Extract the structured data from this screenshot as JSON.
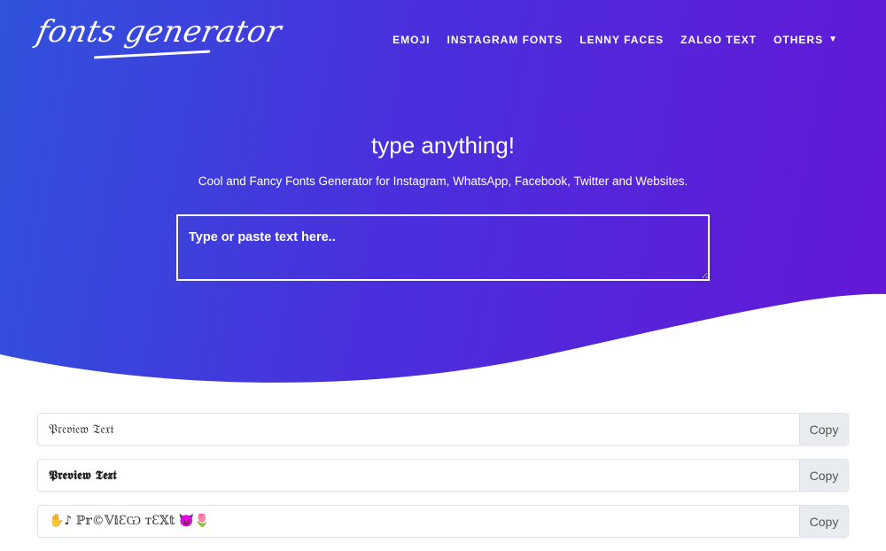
{
  "header": {
    "logo_text": "fonts generator",
    "nav": [
      {
        "label": "EMOJI"
      },
      {
        "label": "INSTAGRAM FONTS"
      },
      {
        "label": "LENNY FACES"
      },
      {
        "label": "ZALGO TEXT"
      },
      {
        "label": "OTHERS",
        "icon": "chevron-down-icon"
      }
    ]
  },
  "hero": {
    "title": "type anything!",
    "subtitle": "Cool and Fancy Fonts Generator for Instagram, WhatsApp, Facebook, Twitter and Websites.",
    "input_placeholder": "Type or paste text here..",
    "input_value": ""
  },
  "results": [
    {
      "text": "𝔓𝔯𝔢𝔳𝔦𝔢𝔴 𝔗𝔢𝔵𝔱",
      "copy_label": "Copy"
    },
    {
      "text": "𝕻𝖗𝖊𝖛𝖎𝖊𝖜 𝕿𝖊𝖝𝖙",
      "copy_label": "Copy"
    },
    {
      "text": "✋♪ ℙ𝕣©𝕍𝕚ƐѠ ᴛƐ𝕏𝕥 😈🌷",
      "copy_label": "Copy"
    }
  ],
  "colors": {
    "gradient_start": "#3052dc",
    "gradient_end": "#6417d6",
    "copy_bg": "#e9ecef"
  }
}
